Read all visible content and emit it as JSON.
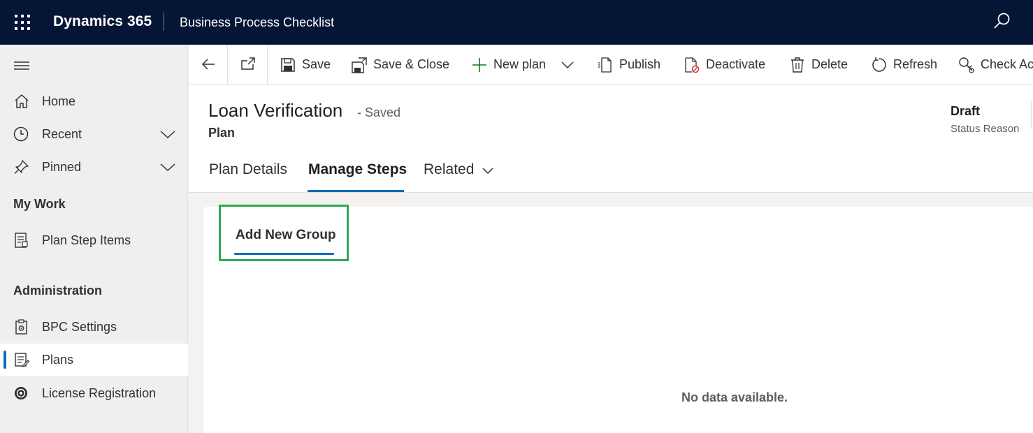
{
  "topbar": {
    "brand": "Dynamics 365",
    "app_title": "Business Process Checklist",
    "background": "#041535"
  },
  "sidebar": {
    "items": [
      {
        "label": "Home",
        "icon": "home-icon"
      },
      {
        "label": "Recent",
        "icon": "clock-icon"
      },
      {
        "label": "Pinned",
        "icon": "pin-icon"
      }
    ],
    "my_work_title": "My Work",
    "my_work_items": [
      {
        "label": "Plan Step Items",
        "icon": "document-icon"
      }
    ],
    "admin_title": "Administration",
    "admin_items": [
      {
        "label": "BPC Settings",
        "icon": "settings-clipboard-icon"
      },
      {
        "label": "Plans",
        "icon": "plans-list-icon",
        "selected": true
      },
      {
        "label": "License Registration",
        "icon": "license-icon"
      }
    ]
  },
  "commands": {
    "save": "Save",
    "save_close": "Save & Close",
    "new_plan": "New plan",
    "publish": "Publish",
    "deactivate": "Deactivate",
    "delete": "Delete",
    "refresh": "Refresh",
    "check_access": "Check Ac"
  },
  "record": {
    "title": "Loan Verification",
    "saved_status": "- Saved",
    "entity": "Plan",
    "status_value": "Draft",
    "status_label": "Status Reason"
  },
  "tabs": [
    {
      "label": "Plan Details"
    },
    {
      "label": "Manage Steps",
      "active": true
    },
    {
      "label": "Related"
    }
  ],
  "content": {
    "add_group_label": "Add New Group",
    "empty_message": "No data available.",
    "highlight_color": "#2fa84f"
  },
  "colors": {
    "accent": "#0f6cbd"
  }
}
